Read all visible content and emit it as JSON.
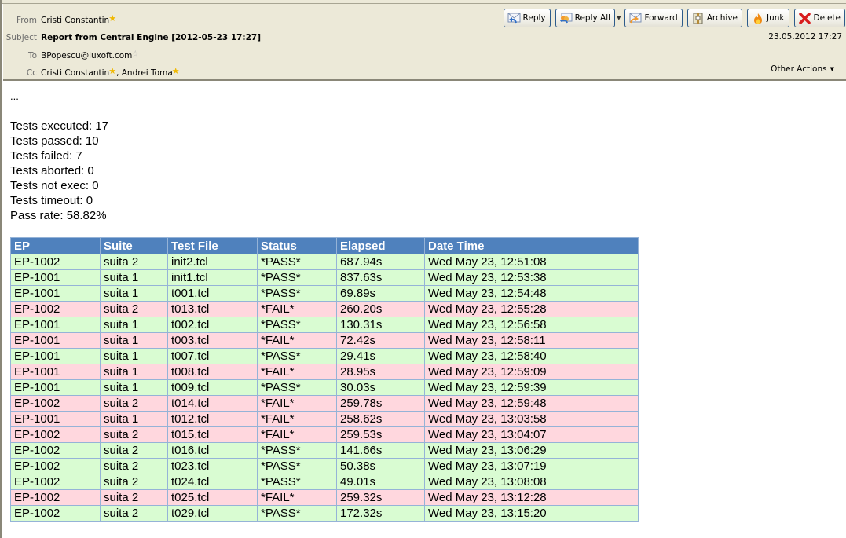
{
  "header": {
    "from_label": "From",
    "from_value": "Cristi Constantin",
    "subject_label": "Subject",
    "subject_value": "Report from Central Engine [2012-05-23 17:27]",
    "to_label": "To",
    "to_value": "BPopescu@luxoft.com",
    "cc_label": "Cc",
    "cc_values": [
      "Cristi Constantin",
      "Andrei Toma"
    ],
    "cc_separator": ", ",
    "date": "23.05.2012 17:27",
    "other_actions": "Other Actions"
  },
  "toolbar": {
    "reply": "Reply",
    "reply_all": "Reply All",
    "forward": "Forward",
    "archive": "Archive",
    "junk": "Junk",
    "delete": "Delete"
  },
  "body": {
    "ellipsis": "...",
    "stats": [
      "Tests executed: 17",
      "Tests passed: 10",
      "Tests failed: 7",
      "Tests aborted: 0",
      "Tests not exec: 0",
      "Tests timeout: 0",
      "Pass rate: 58.82%"
    ]
  },
  "table": {
    "columns": [
      "EP",
      "Suite",
      "Test File",
      "Status",
      "Elapsed",
      "Date Time"
    ],
    "rows": [
      {
        "status_class": "pass",
        "cells": [
          "EP-1002",
          "suita 2",
          "init2.tcl",
          "*PASS*",
          "687.94s",
          "Wed May 23, 12:51:08"
        ]
      },
      {
        "status_class": "pass",
        "cells": [
          "EP-1001",
          "suita 1",
          "init1.tcl",
          "*PASS*",
          "837.63s",
          "Wed May 23, 12:53:38"
        ]
      },
      {
        "status_class": "pass",
        "cells": [
          "EP-1001",
          "suita 1",
          "t001.tcl",
          "*PASS*",
          "69.89s",
          "Wed May 23, 12:54:48"
        ]
      },
      {
        "status_class": "fail",
        "cells": [
          "EP-1002",
          "suita 2",
          "t013.tcl",
          "*FAIL*",
          "260.20s",
          "Wed May 23, 12:55:28"
        ]
      },
      {
        "status_class": "pass",
        "cells": [
          "EP-1001",
          "suita 1",
          "t002.tcl",
          "*PASS*",
          "130.31s",
          "Wed May 23, 12:56:58"
        ]
      },
      {
        "status_class": "fail",
        "cells": [
          "EP-1001",
          "suita 1",
          "t003.tcl",
          "*FAIL*",
          "72.42s",
          "Wed May 23, 12:58:11"
        ]
      },
      {
        "status_class": "pass",
        "cells": [
          "EP-1001",
          "suita 1",
          "t007.tcl",
          "*PASS*",
          "29.41s",
          "Wed May 23, 12:58:40"
        ]
      },
      {
        "status_class": "fail",
        "cells": [
          "EP-1001",
          "suita 1",
          "t008.tcl",
          "*FAIL*",
          "28.95s",
          "Wed May 23, 12:59:09"
        ]
      },
      {
        "status_class": "pass",
        "cells": [
          "EP-1001",
          "suita 1",
          "t009.tcl",
          "*PASS*",
          "30.03s",
          "Wed May 23, 12:59:39"
        ]
      },
      {
        "status_class": "fail",
        "cells": [
          "EP-1002",
          "suita 2",
          "t014.tcl",
          "*FAIL*",
          "259.78s",
          "Wed May 23, 12:59:48"
        ]
      },
      {
        "status_class": "fail",
        "cells": [
          "EP-1001",
          "suita 1",
          "t012.tcl",
          "*FAIL*",
          "258.62s",
          "Wed May 23, 13:03:58"
        ]
      },
      {
        "status_class": "fail",
        "cells": [
          "EP-1002",
          "suita 2",
          "t015.tcl",
          "*FAIL*",
          "259.53s",
          "Wed May 23, 13:04:07"
        ]
      },
      {
        "status_class": "pass",
        "cells": [
          "EP-1002",
          "suita 2",
          "t016.tcl",
          "*PASS*",
          "141.66s",
          "Wed May 23, 13:06:29"
        ]
      },
      {
        "status_class": "pass",
        "cells": [
          "EP-1002",
          "suita 2",
          "t023.tcl",
          "*PASS*",
          "50.38s",
          "Wed May 23, 13:07:19"
        ]
      },
      {
        "status_class": "pass",
        "cells": [
          "EP-1002",
          "suita 2",
          "t024.tcl",
          "*PASS*",
          "49.01s",
          "Wed May 23, 13:08:08"
        ]
      },
      {
        "status_class": "fail",
        "cells": [
          "EP-1002",
          "suita 2",
          "t025.tcl",
          "*FAIL*",
          "259.32s",
          "Wed May 23, 13:12:28"
        ]
      },
      {
        "status_class": "pass",
        "cells": [
          "EP-1002",
          "suita 2",
          "t029.tcl",
          "*PASS*",
          "172.32s",
          "Wed May 23, 13:15:20"
        ]
      }
    ]
  },
  "colors": {
    "header_bg": "#ece9d8",
    "table_header": "#4f81bd",
    "pass_row": "#d9fcd2",
    "fail_row": "#ffd7de",
    "table_border": "#95b3d7"
  }
}
